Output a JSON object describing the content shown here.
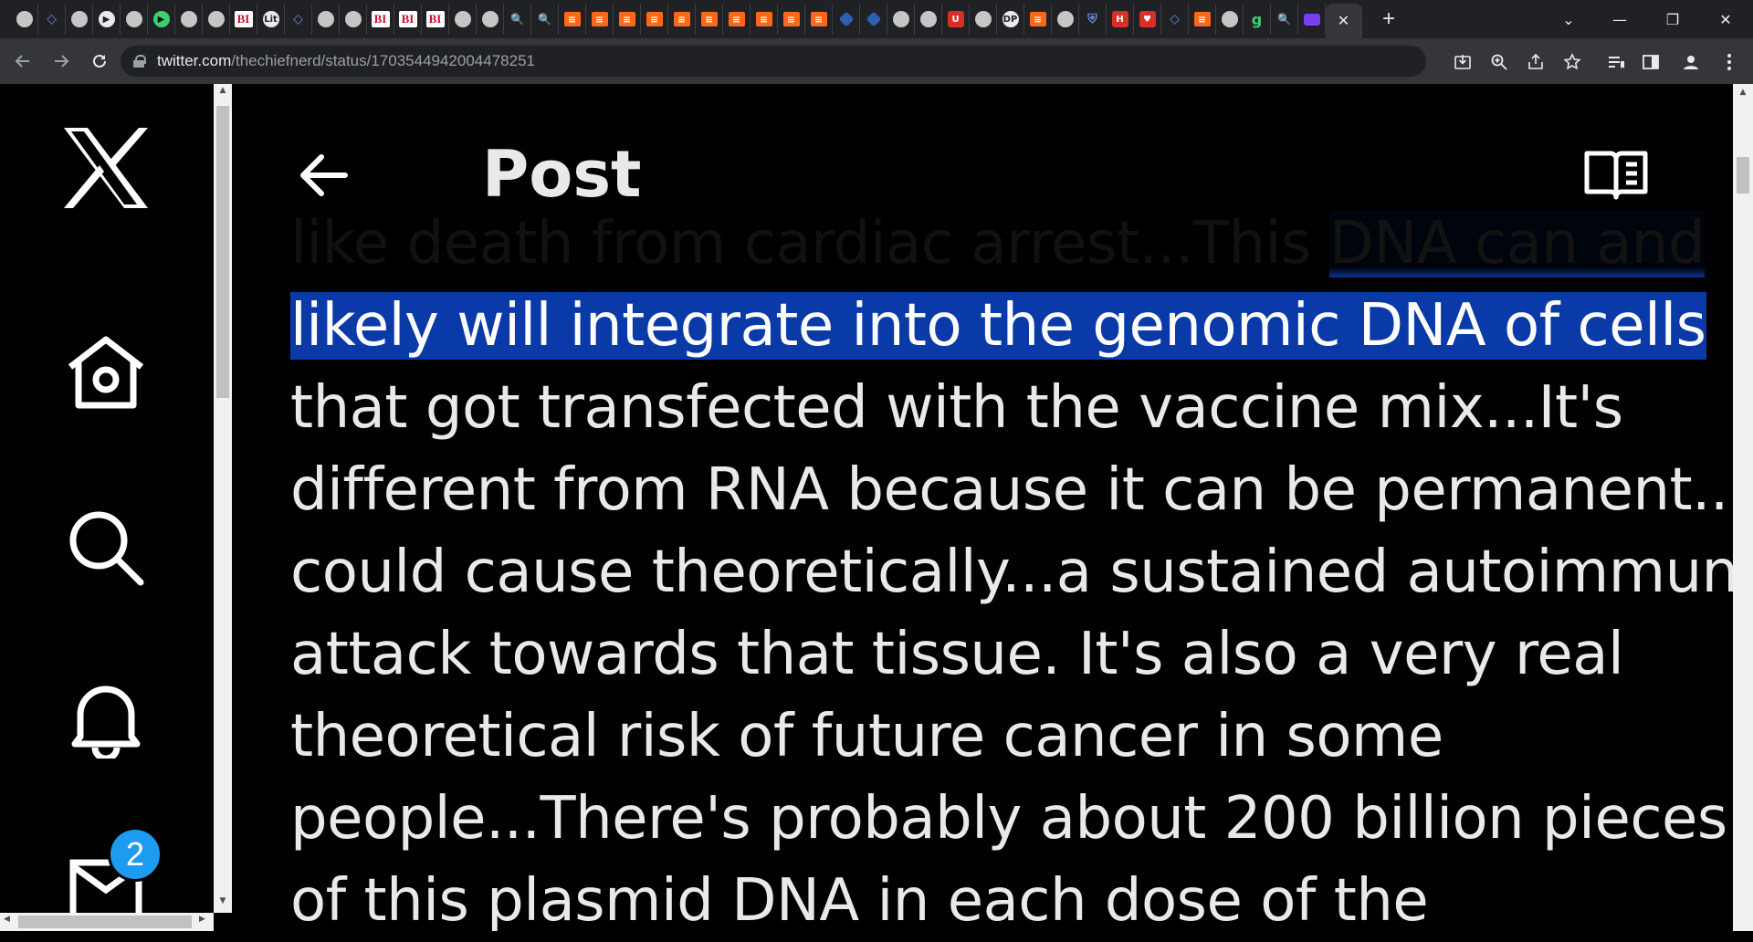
{
  "browser": {
    "active_tab_close": "✕",
    "new_tab": "+",
    "tab_dropdown": "⌄",
    "minimize": "—",
    "restore": "❐",
    "close": "✕",
    "url_host": "twitter.com",
    "url_path": "/thechiefnerd/status/1703544942004478251"
  },
  "tabs": [
    {
      "icon": "globe",
      "text": ""
    },
    {
      "icon": "shield",
      "text": "◇"
    },
    {
      "icon": "globe",
      "text": ""
    },
    {
      "icon": "flag",
      "text": "▶"
    },
    {
      "icon": "globe",
      "text": ""
    },
    {
      "icon": "play",
      "text": "▶"
    },
    {
      "icon": "globe",
      "text": ""
    },
    {
      "icon": "globe",
      "text": ""
    },
    {
      "icon": "bi",
      "text": "BI"
    },
    {
      "icon": "lit",
      "text": "Lit"
    },
    {
      "icon": "shield",
      "text": "◇"
    },
    {
      "icon": "globe",
      "text": ""
    },
    {
      "icon": "globe",
      "text": ""
    },
    {
      "icon": "bi",
      "text": "BI"
    },
    {
      "icon": "bi",
      "text": "BI"
    },
    {
      "icon": "bi",
      "text": "BI"
    },
    {
      "icon": "globe",
      "text": ""
    },
    {
      "icon": "globe",
      "text": ""
    },
    {
      "icon": "search",
      "text": "🔍"
    },
    {
      "icon": "search",
      "text": "🔍"
    },
    {
      "icon": "sub",
      "text": "≡"
    },
    {
      "icon": "sub",
      "text": "≡"
    },
    {
      "icon": "sub",
      "text": "≡"
    },
    {
      "icon": "sub",
      "text": "≡"
    },
    {
      "icon": "sub",
      "text": "≡"
    },
    {
      "icon": "sub",
      "text": "≡"
    },
    {
      "icon": "sub",
      "text": "≡"
    },
    {
      "icon": "sub",
      "text": "≡"
    },
    {
      "icon": "sub",
      "text": "≡"
    },
    {
      "icon": "sub",
      "text": "≡"
    },
    {
      "icon": "hex",
      "text": ""
    },
    {
      "icon": "hex",
      "text": ""
    },
    {
      "icon": "globe",
      "text": ""
    },
    {
      "icon": "globe",
      "text": ""
    },
    {
      "icon": "red",
      "text": "U"
    },
    {
      "icon": "globe",
      "text": ""
    },
    {
      "icon": "dpic",
      "text": "DP"
    },
    {
      "icon": "sub",
      "text": "≡"
    },
    {
      "icon": "globe",
      "text": ""
    },
    {
      "icon": "shield",
      "text": "⛨"
    },
    {
      "icon": "red",
      "text": "H"
    },
    {
      "icon": "red",
      "text": "♥"
    },
    {
      "icon": "shield",
      "text": "◇"
    },
    {
      "icon": "sub",
      "text": "≡"
    },
    {
      "icon": "globe",
      "text": ""
    },
    {
      "icon": "g",
      "text": "g"
    },
    {
      "icon": "search",
      "text": "🔍"
    },
    {
      "icon": "mail",
      "text": ""
    }
  ],
  "x": {
    "header_title": "Post",
    "notification_count": "2",
    "post_lines": [
      {
        "pre": "like death from cardiac arrest...This ",
        "hl": "DNA can and "
      },
      {
        "pre": "",
        "hl": "likely will integrate into the genomic DNA of cells"
      },
      {
        "pre": "that got transfected with the vaccine mix...It's",
        "hl": ""
      },
      {
        "pre": "different from RNA because it can be permanent...It",
        "hl": ""
      },
      {
        "pre": "could cause theoretically...a sustained autoimmune",
        "hl": ""
      },
      {
        "pre": "attack towards that tissue. It's also a very real",
        "hl": ""
      },
      {
        "pre": "theoretical risk of future cancer in some",
        "hl": ""
      },
      {
        "pre": "people...There's probably about 200 billion pieces",
        "hl": ""
      },
      {
        "pre": "of this plasmid DNA in each dose of the",
        "hl": ""
      }
    ]
  },
  "colors": {
    "highlight": "#0a3aa8",
    "badge": "#1d9bf0",
    "text": "#e7e9ea"
  }
}
